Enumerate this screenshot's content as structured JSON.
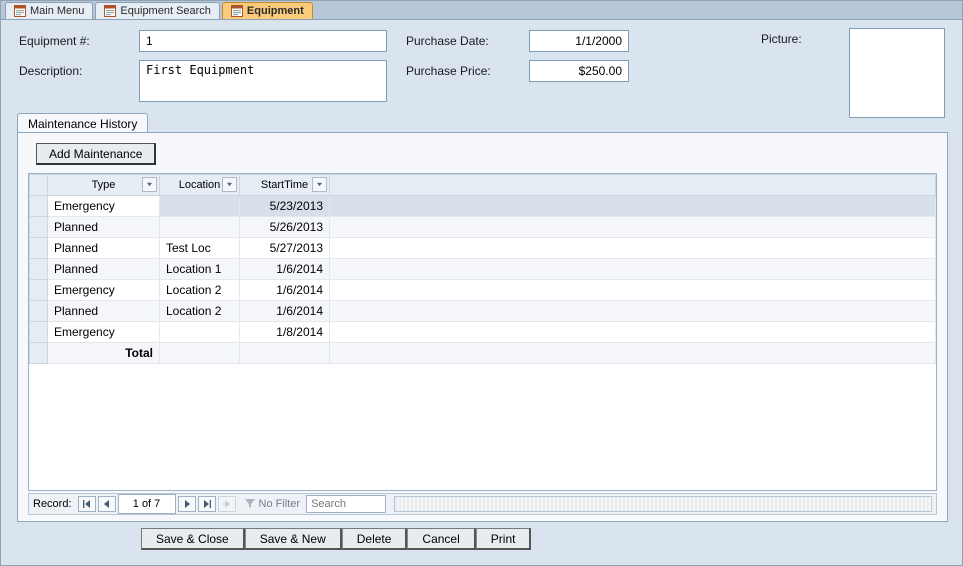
{
  "tabs": [
    {
      "label": "Main Menu",
      "active": false
    },
    {
      "label": "Equipment Search",
      "active": false
    },
    {
      "label": "Equipment",
      "active": true
    }
  ],
  "labels": {
    "equipment_num": "Equipment #:",
    "description": "Description:",
    "purchase_date": "Purchase Date:",
    "purchase_price": "Purchase Price:",
    "picture": "Picture:"
  },
  "fields": {
    "equipment_num": "1",
    "description": "First Equipment",
    "purchase_date": "1/1/2000",
    "purchase_price": "$250.00"
  },
  "subtab": {
    "label": "Maintenance History"
  },
  "buttons": {
    "add_maintenance": "Add Maintenance",
    "save_close": "Save & Close",
    "save_new": "Save & New",
    "delete": "Delete",
    "cancel": "Cancel",
    "print": "Print"
  },
  "grid": {
    "columns": [
      "Type",
      "Location",
      "StartTime"
    ],
    "rows": [
      {
        "type": "Emergency",
        "location": "",
        "start": "5/23/2013",
        "selected": true
      },
      {
        "type": "Planned",
        "location": "",
        "start": "5/26/2013"
      },
      {
        "type": "Planned",
        "location": "Test Loc",
        "start": "5/27/2013"
      },
      {
        "type": "Planned",
        "location": "Location 1",
        "start": "1/6/2014"
      },
      {
        "type": "Emergency",
        "location": "Location 2",
        "start": "1/6/2014"
      },
      {
        "type": "Planned",
        "location": "Location 2",
        "start": "1/6/2014"
      },
      {
        "type": "Emergency",
        "location": "",
        "start": "1/8/2014"
      }
    ],
    "total_label": "Total"
  },
  "recnav": {
    "label": "Record:",
    "position": "1 of 7",
    "filter_label": "No Filter",
    "search_placeholder": "Search"
  }
}
